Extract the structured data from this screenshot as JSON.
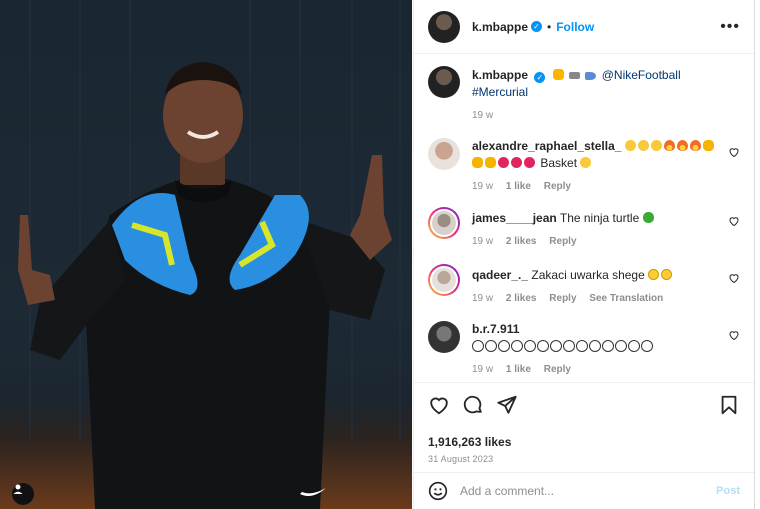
{
  "post": {
    "username": "k.mbappe",
    "follow_label": "Follow",
    "separator": "•",
    "more_label": "•••",
    "likes": "1,916,263 likes",
    "date": "31 August 2023"
  },
  "caption": {
    "username": "k.mbappe",
    "mention": "@NikeFootball",
    "hashtag": "#Mercurial",
    "time": "19 w"
  },
  "comments": [
    {
      "username": "alexandre_raphael_stella_",
      "text": "Basket",
      "time": "19 w",
      "likes": "1 like",
      "reply": "Reply"
    },
    {
      "username": "james____jean",
      "text": "The ninja turtle",
      "time": "19 w",
      "likes": "2 likes",
      "reply": "Reply"
    },
    {
      "username": "qadeer_._",
      "text": "Zakaci uwarka shege",
      "time": "19 w",
      "likes": "2 likes",
      "reply": "Reply",
      "translate": "See Translation"
    },
    {
      "username": "b.r.7.911",
      "text": "",
      "time": "19 w",
      "likes": "1 like",
      "reply": "Reply"
    }
  ],
  "composer": {
    "placeholder": "Add a comment...",
    "post_label": "Post"
  },
  "icons": {
    "like": "heart-icon",
    "comment": "comment-icon",
    "share": "share-icon",
    "save": "bookmark-icon",
    "emoji": "emoji-icon"
  },
  "colors": {
    "accent": "#0095f6",
    "muted": "#8e8e8e",
    "post_disabled": "#b2dffc"
  }
}
